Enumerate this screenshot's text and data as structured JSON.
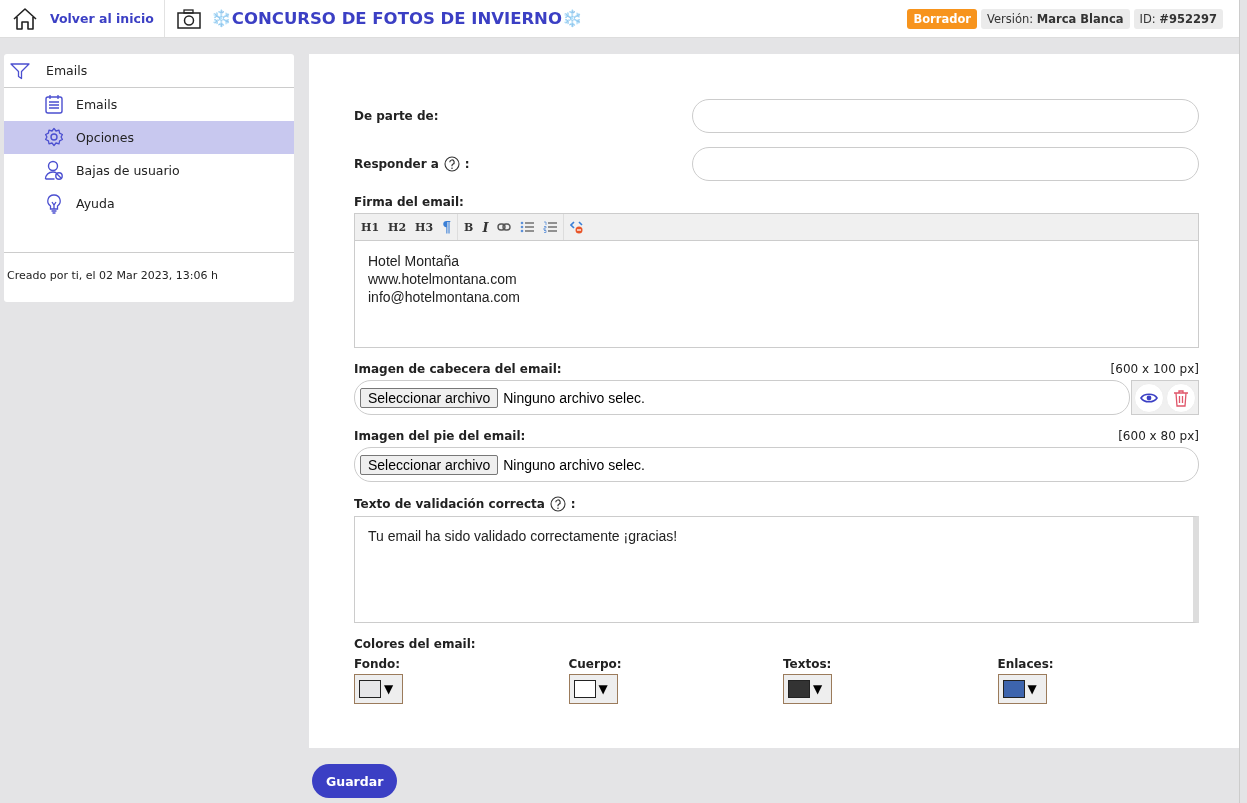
{
  "header": {
    "back_link": "Volver al inicio",
    "title": "❄️CONCURSO DE FOTOS DE INVIERNO❄️",
    "status_badge": "Borrador",
    "version": "Versión: **Marca Blanca**",
    "id": "ID: **#952297**"
  },
  "sidebar": {
    "title": "Emails",
    "items": [
      {
        "label": "Emails",
        "selected": false
      },
      {
        "label": "Opciones",
        "selected": true
      },
      {
        "label": "Bajas de usuario",
        "selected": false
      },
      {
        "label": "Ayuda",
        "selected": false
      }
    ],
    "footer": "Creado por ti, el 02 Mar 2023, 13:06 h"
  },
  "form": {
    "fields": [
      {
        "label": "De parte de:",
        "help": false
      },
      {
        "label": "Responder a",
        "help": true,
        "suffix": ":"
      }
    ],
    "signature": {
      "label": "Firma del email:",
      "toolbar_groups": [
        [
          "H1",
          "H2",
          "H3",
          "¶"
        ],
        [
          "B",
          "I"
        ]
      ],
      "lines": [
        "Hotel Montaña",
        "www.hotelmontana.com",
        "info@hotelmontana.com"
      ]
    },
    "images": [
      {
        "label": "Imagen de cabecera del email:",
        "size": "[600 x 100 px]",
        "button": "Seleccionar archivo",
        "file": "Ninguno archivo selec.",
        "has_actions": true
      },
      {
        "label": "Imagen del pie del email:",
        "size": "[600 x 80 px]",
        "button": "Seleccionar archivo",
        "file": "Ninguno archivo selec.",
        "has_actions": false
      }
    ],
    "validation": {
      "label": "Texto de validación correcta",
      "suffix": ":",
      "value": "Tu email ha sido validado correctamente ¡gracias!"
    },
    "colors": {
      "label": "Colores del email:",
      "items": [
        {
          "label": "Fondo:",
          "color": "#e6e6e8",
          "arrow": "▼"
        },
        {
          "label": "Cuerpo:",
          "color": "#ffffff",
          "arrow": "▼"
        },
        {
          "label": "Textos:",
          "color": "#333333",
          "arrow": "▼"
        },
        {
          "label": "Enlaces:",
          "color": "#3d64ad",
          "arrow": "▼"
        }
      ]
    }
  },
  "save_button": "Guardar"
}
